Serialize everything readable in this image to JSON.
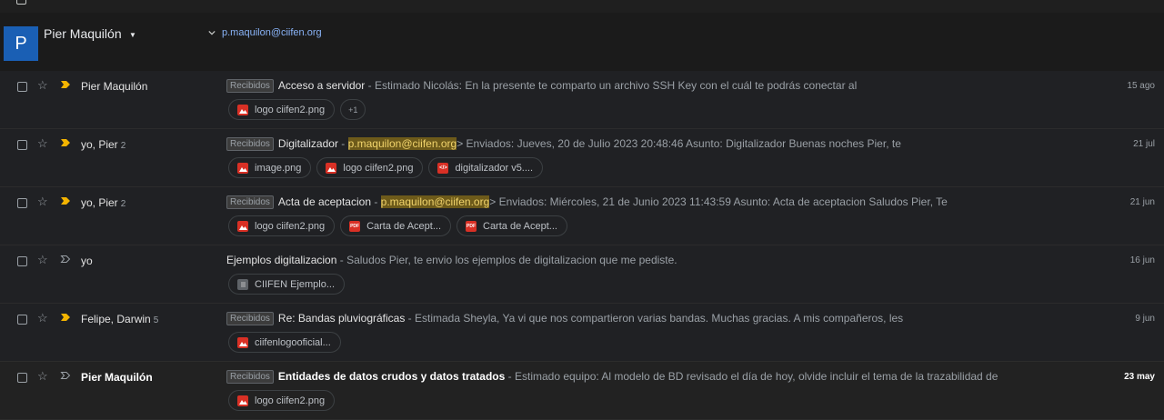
{
  "header": {
    "avatar_letter": "P",
    "account_name": "Pier Maquilón",
    "account_email": "p.maquilon@ciifen.org"
  },
  "emails": [
    {
      "sender": "Pier Maquilón",
      "count": "",
      "label": "Recibidos",
      "subject": "Acceso a servidor",
      "snippet_pre": " - Estimado Nicolás: En la presente te comparto un archivo SSH Key con el cuál te podrás conectar al",
      "highlight": "",
      "snippet_post": "",
      "date": "15 ago",
      "unread": false,
      "important": true,
      "attachments": [
        {
          "name": "logo ciifen2.png",
          "type": "image"
        }
      ],
      "more": "+1"
    },
    {
      "sender": "yo, Pier",
      "count": "2",
      "label": "Recibidos",
      "subject": "Digitalizador",
      "snippet_pre": " - ",
      "highlight": "p.maquilon@ciifen.org",
      "snippet_post": "> Enviados: Jueves, 20 de Julio 2023 20:48:46 Asunto: Digitalizador Buenas noches Pier, te",
      "date": "21 jul",
      "unread": false,
      "important": true,
      "attachments": [
        {
          "name": "image.png",
          "type": "image"
        },
        {
          "name": "logo ciifen2.png",
          "type": "image"
        },
        {
          "name": "digitalizador v5....",
          "type": "code"
        }
      ],
      "more": ""
    },
    {
      "sender": "yo, Pier",
      "count": "2",
      "label": "Recibidos",
      "subject": "Acta de aceptacion",
      "snippet_pre": " - ",
      "highlight": "p.maquilon@ciifen.org",
      "snippet_post": "> Enviados: Miércoles, 21 de Junio 2023 11:43:59 Asunto: Acta de aceptacion Saludos Pier, Te",
      "date": "21 jun",
      "unread": false,
      "important": true,
      "attachments": [
        {
          "name": "logo ciifen2.png",
          "type": "image"
        },
        {
          "name": "Carta de Acept...",
          "type": "pdf"
        },
        {
          "name": "Carta de Acept...",
          "type": "pdf"
        }
      ],
      "more": ""
    },
    {
      "sender": "yo",
      "count": "",
      "label": "",
      "subject": "Ejemplos digitalizacion",
      "snippet_pre": " - Saludos Pier, te envio los ejemplos de digitalizacion que me pediste.",
      "highlight": "",
      "snippet_post": "",
      "date": "16 jun",
      "unread": false,
      "important": false,
      "attachments": [
        {
          "name": "CIIFEN Ejemplo...",
          "type": "doc"
        }
      ],
      "more": ""
    },
    {
      "sender": "Felipe, Darwin",
      "count": "5",
      "label": "Recibidos",
      "subject": "Re: Bandas pluviográficas",
      "snippet_pre": " - Estimada Sheyla, Ya vi que nos compartieron varias bandas. Muchas gracias. A mis compañeros, les",
      "highlight": "",
      "snippet_post": "",
      "date": "9 jun",
      "unread": false,
      "important": true,
      "attachments": [
        {
          "name": "ciifenlogooficial...",
          "type": "image"
        }
      ],
      "more": ""
    },
    {
      "sender": "Pier Maquilón",
      "count": "",
      "label": "Recibidos",
      "subject": "Entidades de datos crudos y datos tratados",
      "snippet_pre": " - Estimado equipo: Al modelo de BD revisado el día de hoy, olvide incluir el tema de la trazabilidad de",
      "highlight": "",
      "snippet_post": "",
      "date": "23 may",
      "unread": true,
      "important": false,
      "attachments": [
        {
          "name": "logo ciifen2.png",
          "type": "image"
        }
      ],
      "more": ""
    }
  ],
  "colors": {
    "background": "#1f1f1f",
    "important_marker": "#f4b400",
    "image_icon": "#d93025",
    "pdf_icon": "#d93025",
    "doc_icon": "#5f6368",
    "highlight": "#6d5a1a",
    "link": "#8ab4f8"
  }
}
